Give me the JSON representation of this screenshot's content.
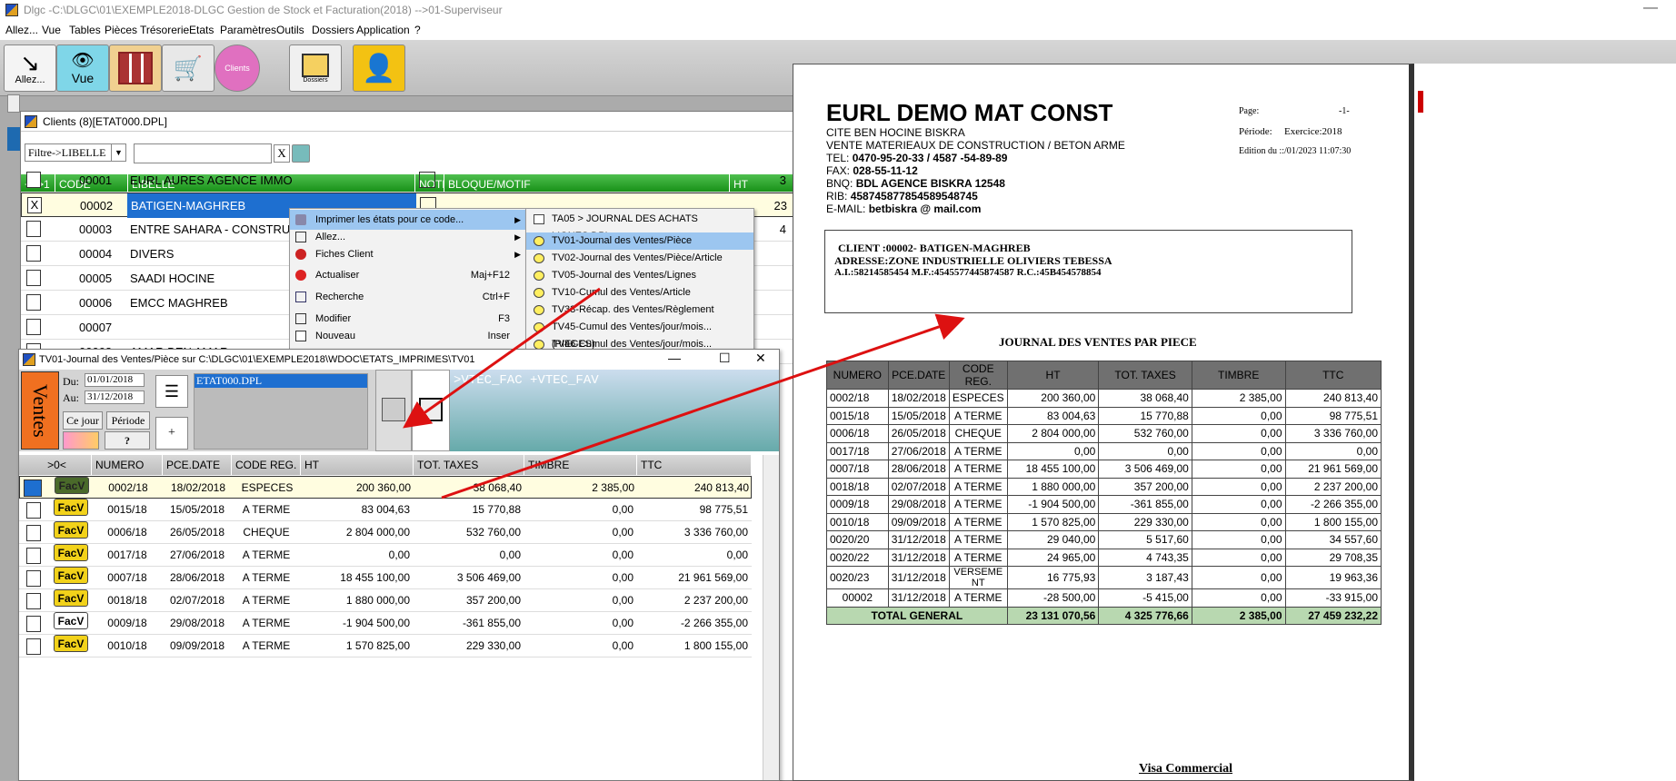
{
  "window_title": "Dlgc -C:\\DLGC\\01\\EXEMPLE2018-DLGC Gestion de Stock et Facturation(2018) -->01-Superviseur",
  "menu": [
    "Allez...",
    "Vue",
    "Tables",
    "Pièces",
    "Trésorerie",
    "Etats",
    "Paramètres",
    "Outils",
    "Dossiers",
    "Application",
    "?"
  ],
  "toolbar": {
    "allez": "Allez...",
    "vue": "Vue",
    "clients": "Clients",
    "dossiers": "Dossiers"
  },
  "clients_window": {
    "title": "Clients (8)[ETAT000.DPL]",
    "filter_label": "Filtre->LIBELLE",
    "clear_label": "X",
    "headers": [
      "++>1",
      "CODE",
      "LIBELLE",
      "NOTE",
      "BLOQUE/MOTIF",
      "HT"
    ],
    "rows": [
      {
        "check": "",
        "code": "00001",
        "libelle": "EURL AURES AGENCE IMMO",
        "ht": "3"
      },
      {
        "check": "X",
        "code": "00002",
        "libelle": "BATIGEN-MAGHREB",
        "ht": "23"
      },
      {
        "check": "",
        "code": "00003",
        "libelle": "ENTRE SAHARA - CONSTRUCTION",
        "ht": "4"
      },
      {
        "check": "",
        "code": "00004",
        "libelle": "DIVERS",
        "ht": ""
      },
      {
        "check": "",
        "code": "00005",
        "libelle": "SAADI HOCINE",
        "ht": ""
      },
      {
        "check": "",
        "code": "00006",
        "libelle": "EMCC MAGHREB",
        "ht": ""
      },
      {
        "check": "",
        "code": "00007",
        "libelle": "",
        "ht": ""
      },
      {
        "check": "",
        "code": "00008",
        "libelle": "AMAR BEN AMAR",
        "ht": ""
      }
    ]
  },
  "context_menu": [
    {
      "label": "Imprimer les états pour ce code...",
      "shortcut": "",
      "sub": true
    },
    {
      "label": "Allez...",
      "shortcut": "",
      "sub": true
    },
    {
      "label": "Fiches Client",
      "shortcut": "",
      "sub": true
    },
    {
      "label": "Actualiser",
      "shortcut": "Maj+F12",
      "sub": false
    },
    {
      "label": "Recherche",
      "shortcut": "Ctrl+F",
      "sub": false
    },
    {
      "label": "Modifier",
      "shortcut": "F3",
      "sub": false
    },
    {
      "label": "Nouveau",
      "shortcut": "Inser",
      "sub": false
    }
  ],
  "submenu": [
    "TA05 > JOURNAL DES ACHATS LIGNES.DPL",
    "TV01-Journal des Ventes/Pièce",
    "TV02-Journal des Ventes/Pièce/Article",
    "TV05-Journal des Ventes/Lignes",
    "TV10-Cumul des Ventes/Article",
    "TV33-Récap. des Ventes/Règlement",
    "TV45-Cumul des Ventes/jour/mois...(PIECES)",
    "TV46-Cumul des Ventes/jour/mois...(LIGNES)"
  ],
  "tv01_window": {
    "title": "TV01-Journal des Ventes/Pièce sur C:\\DLGC\\01\\EXEMPLE2018\\WDOC\\ETATS_IMPRIMES\\TV01",
    "ventes_label": "Ventes",
    "du_label": "Du:",
    "du_value": "01/01/2018",
    "au_label": "Au:",
    "au_value": "31/12/2018",
    "cejour": "Ce jour",
    "periode": "Période",
    "help": "?",
    "file": "ETAT000.DPL",
    "sql": ">VTEC_FAC  +VTEC_FAV",
    "headers": [
      ">0<",
      "NUMERO",
      "PCE.DATE",
      "CODE REG.",
      "HT",
      "TOT. TAXES",
      "TIMBRE",
      "TTC"
    ],
    "badge": "FacV",
    "rows": [
      {
        "num": "0002/18",
        "date": "18/02/2018",
        "reg": "ESPECES",
        "ht": "200 360,00",
        "tax": "38 068,40",
        "tim": "2 385,00",
        "ttc": "240 813,40"
      },
      {
        "num": "0015/18",
        "date": "15/05/2018",
        "reg": "A TERME",
        "ht": "83 004,63",
        "tax": "15 770,88",
        "tim": "0,00",
        "ttc": "98 775,51"
      },
      {
        "num": "0006/18",
        "date": "26/05/2018",
        "reg": "CHEQUE",
        "ht": "2 804 000,00",
        "tax": "532 760,00",
        "tim": "0,00",
        "ttc": "3 336 760,00"
      },
      {
        "num": "0017/18",
        "date": "27/06/2018",
        "reg": "A TERME",
        "ht": "0,00",
        "tax": "0,00",
        "tim": "0,00",
        "ttc": "0,00"
      },
      {
        "num": "0007/18",
        "date": "28/06/2018",
        "reg": "A TERME",
        "ht": "18 455 100,00",
        "tax": "3 506 469,00",
        "tim": "0,00",
        "ttc": "21 961 569,00"
      },
      {
        "num": "0018/18",
        "date": "02/07/2018",
        "reg": "A TERME",
        "ht": "1 880 000,00",
        "tax": "357 200,00",
        "tim": "0,00",
        "ttc": "2 237 200,00"
      },
      {
        "num": "0009/18",
        "date": "29/08/2018",
        "reg": "A TERME",
        "ht": "-1 904 500,00",
        "tax": "-361 855,00",
        "tim": "0,00",
        "ttc": "-2 266 355,00"
      },
      {
        "num": "0010/18",
        "date": "09/09/2018",
        "reg": "A TERME",
        "ht": "1 570 825,00",
        "tax": "229 330,00",
        "tim": "0,00",
        "ttc": "1 800 155,00"
      }
    ]
  },
  "report": {
    "company": "EURL DEMO MAT CONST",
    "lines": [
      "CITE BEN HOCINE BISKRA",
      "VENTE MATERIEAUX DE CONSTRUCTION  / BETON ARME"
    ],
    "tel_label": "TEL:",
    "tel": "0470-95-20-33 / 4587 -54-89-89",
    "fax_label": "FAX:",
    "fax": "028-55-11-12",
    "bnq_label": "BNQ:",
    "bnq": "BDL AGENCE BISKRA 12548",
    "rib_label": "RIB:",
    "rib": "458745877854589548745",
    "email_label": "E-MAIL:",
    "email": "betbiskra @ mail.com",
    "page_label": "Page:",
    "page": "-1-",
    "periode_label": "Période:",
    "periode": "Exercice:2018",
    "edition": "Edition du ::/01/2023 11:07:30",
    "client_line": "CLIENT :00002- BATIGEN-MAGHREB",
    "adresse_line": "ADRESSE:ZONE INDUSTRIELLE OLIVIERS TEBESSA",
    "ids_line": "A.I.:58214585454  M.F.:4545577445874587  R.C.:45B454578854",
    "journal_title": "JOURNAL DES VENTES  PAR PIECE",
    "headers": [
      "NUMERO",
      "PCE.DATE",
      "CODE REG.",
      "HT",
      "TOT. TAXES",
      "TIMBRE",
      "TTC"
    ],
    "rows": [
      [
        "0002/18",
        "18/02/2018",
        "ESPECES",
        "200 360,00",
        "38 068,40",
        "2 385,00",
        "240 813,40"
      ],
      [
        "0015/18",
        "15/05/2018",
        "A TERME",
        "83 004,63",
        "15 770,88",
        "0,00",
        "98 775,51"
      ],
      [
        "0006/18",
        "26/05/2018",
        "CHEQUE",
        "2 804 000,00",
        "532 760,00",
        "0,00",
        "3 336 760,00"
      ],
      [
        "0017/18",
        "27/06/2018",
        "A TERME",
        "0,00",
        "0,00",
        "0,00",
        "0,00"
      ],
      [
        "0007/18",
        "28/06/2018",
        "A TERME",
        "18 455 100,00",
        "3 506 469,00",
        "0,00",
        "21 961 569,00"
      ],
      [
        "0018/18",
        "02/07/2018",
        "A TERME",
        "1 880 000,00",
        "357 200,00",
        "0,00",
        "2 237 200,00"
      ],
      [
        "0009/18",
        "29/08/2018",
        "A TERME",
        "-1 904 500,00",
        "-361 855,00",
        "0,00",
        "-2 266 355,00"
      ],
      [
        "0010/18",
        "09/09/2018",
        "A TERME",
        "1 570 825,00",
        "229 330,00",
        "0,00",
        "1 800 155,00"
      ],
      [
        "0020/20",
        "31/12/2018",
        "A TERME",
        "29 040,00",
        "5 517,60",
        "0,00",
        "34 557,60"
      ],
      [
        "0020/22",
        "31/12/2018",
        "A TERME",
        "24 965,00",
        "4 743,35",
        "0,00",
        "29 708,35"
      ],
      [
        "0020/23",
        "31/12/2018",
        "VERSEME NT",
        "16 775,93",
        "3 187,43",
        "0,00",
        "19 963,36"
      ],
      [
        "00002",
        "31/12/2018",
        "A TERME",
        "-28 500,00",
        "-5 415,00",
        "0,00",
        "-33 915,00"
      ]
    ],
    "total_label": "TOTAL GENERAL",
    "totals": [
      "23 131 070,56",
      "4 325 776,66",
      "2 385,00",
      "27 459 232,22"
    ],
    "visa": "Visa Commercial"
  }
}
